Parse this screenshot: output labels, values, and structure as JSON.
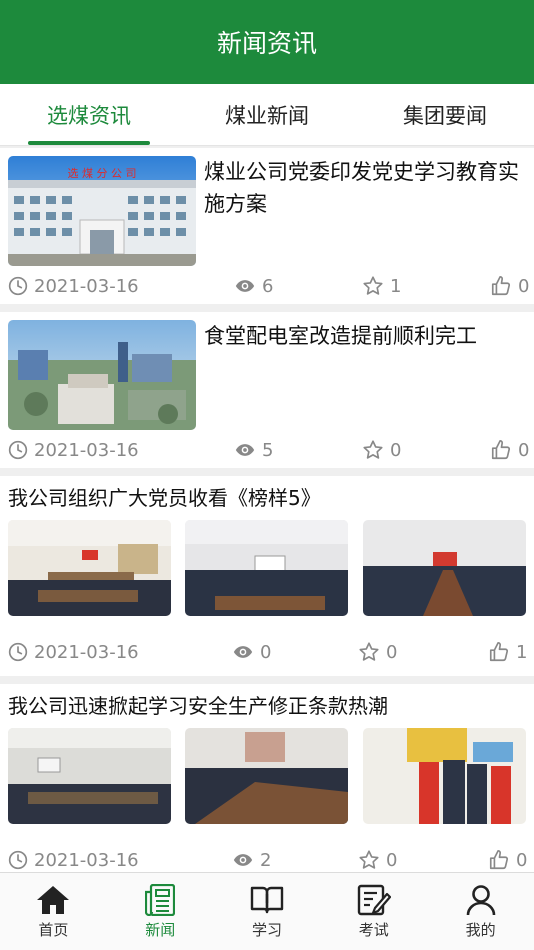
{
  "header": {
    "title": "新闻资讯"
  },
  "tabs": [
    {
      "label": "选煤资讯",
      "active": true
    },
    {
      "label": "煤业新闻",
      "active": false
    },
    {
      "label": "集团要闻",
      "active": false
    }
  ],
  "articles": [
    {
      "title": "煤业公司党委印发党史学习教育实施方案",
      "date": "2021-03-16",
      "views": "6",
      "favorites": "1",
      "likes": "0",
      "image_sign": "选 煤 分 公 司"
    },
    {
      "title": "食堂配电室改造提前顺利完工",
      "date": "2021-03-16",
      "views": "5",
      "favorites": "0",
      "likes": "0"
    },
    {
      "title": "我公司组织广大党员收看《榜样5》",
      "date": "2021-03-16",
      "views": "0",
      "favorites": "0",
      "likes": "1"
    },
    {
      "title": "我公司迅速掀起学习安全生产修正条款热潮",
      "date": "2021-03-16",
      "views": "2",
      "favorites": "0",
      "likes": "0"
    }
  ],
  "bottom_nav": [
    {
      "label": "首页",
      "icon": "home-icon",
      "active": false
    },
    {
      "label": "新闻",
      "icon": "news-icon",
      "active": true
    },
    {
      "label": "学习",
      "icon": "book-icon",
      "active": false
    },
    {
      "label": "考试",
      "icon": "exam-icon",
      "active": false
    },
    {
      "label": "我的",
      "icon": "profile-icon",
      "active": false
    }
  ],
  "colors": {
    "brand": "#1d8a3c",
    "meta_text": "#888888",
    "background": "#efefef"
  }
}
